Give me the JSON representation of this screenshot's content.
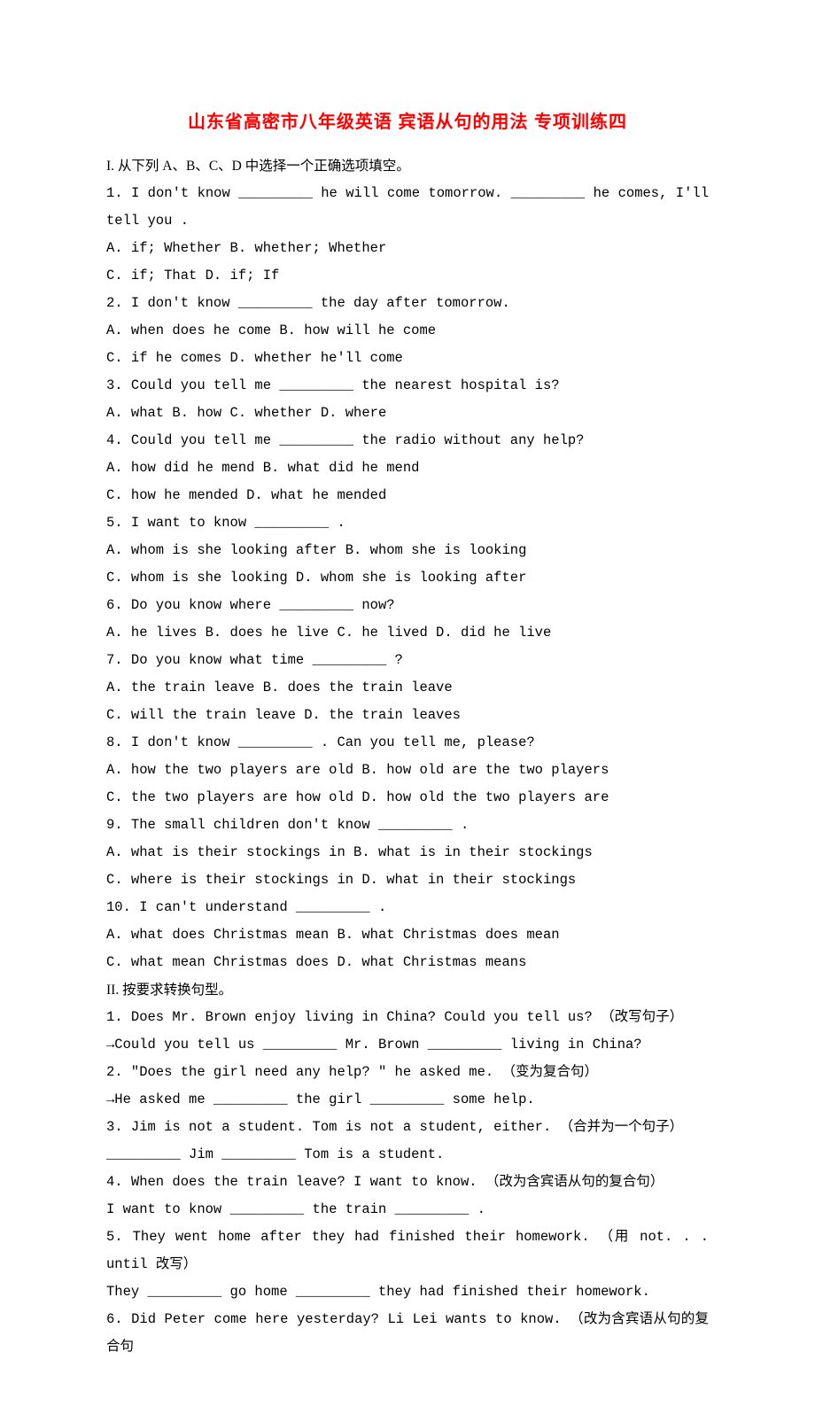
{
  "title": "山东省高密市八年级英语 宾语从句的用法 专项训练四",
  "section1": {
    "heading": "I. 从下列 A、B、C、D 中选择一个正确选项填空。",
    "q1": "1. I don't know _________ he will come tomorrow. _________ he comes, I'll tell you .",
    "q1o": "A. if; Whether B. whether; Whether",
    "q1o2": "C. if; That D. if; If",
    "q2": "2. I don't know _________ the day after tomorrow.",
    "q2o": "A. when does he come B. how will he come",
    "q2o2": "C. if he comes D. whether he'll come",
    "q3": "3. Could you tell me _________ the nearest hospital is?",
    "q3o": "A. what B. how C. whether D. where",
    "q4": "4. Could you tell me _________ the radio without any help?",
    "q4o": "A. how did he mend B. what did he mend",
    "q4o2": "C. how he mended D. what he mended",
    "q5": "5. I want to know _________ .",
    "q5o": "A. whom is she looking after B. whom she is looking",
    "q5o2": "C. whom is she looking D. whom she is looking after",
    "q6": "6. Do you know where _________ now?",
    "q6o": "A. he lives B. does he live C. he lived D. did he live",
    "q7": "7. Do you know what time _________ ?",
    "q7o": "A. the train leave B. does the train leave",
    "q7o2": "C. will the train leave D. the train leaves",
    "q8": "8. I don't know _________ . Can you tell me, please?",
    "q8o": "A. how the two players are old B. how old are the two players",
    "q8o2": "C. the two players are how old D. how old the two players are",
    "q9": "9. The small children don't know _________ .",
    "q9o": "A. what is their stockings in B. what is in their stockings",
    "q9o2": "C. where is their stockings in D. what in their stockings",
    "q10": "10. I can't understand _________ .",
    "q10o": "A. what does Christmas mean B. what Christmas does mean",
    "q10o2": "C. what mean Christmas does D. what Christmas means"
  },
  "section2": {
    "heading": "II. 按要求转换句型。",
    "q1": "1. Does Mr. Brown enjoy living in China? Could you tell us? （改写句子）",
    "q1a": "→Could you tell us _________ Mr. Brown _________ living in China?",
    "q2": "2. \"Does the girl need any help? \" he asked me. （变为复合句）",
    "q2a": "→He asked me _________ the girl _________ some help.",
    "q3": "3. Jim is not a student. Tom is not a student, either. （合并为一个句子）",
    "q3a": "_________ Jim _________ Tom is a student.",
    "q4": "4. When does the train leave? I want to know. （改为含宾语从句的复合句）",
    "q4a": "I want to know _________ the train _________ .",
    "q5": "5. They went home after they had finished their homework. （用 not. . . until 改写）",
    "q5a": "They _________ go home _________ they had finished their homework.",
    "q6": "6. Did Peter come here yesterday? Li Lei wants to know. （改为含宾语从句的复合句"
  }
}
